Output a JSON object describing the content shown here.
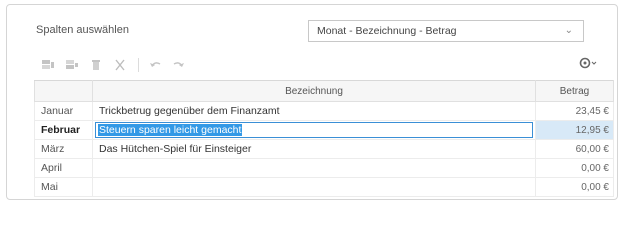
{
  "header": {
    "title": "Spalten auswählen",
    "column_select": {
      "value": "Monat - Bezeichnung - Betrag"
    }
  },
  "toolbar": {
    "icons": [
      "add-row-icon",
      "insert-row-icon",
      "delete-icon",
      "cut-icon",
      "undo-icon",
      "redo-icon",
      "settings-gear-icon"
    ]
  },
  "table": {
    "columns": [
      "",
      "Bezeichnung",
      "Betrag"
    ],
    "rows": [
      {
        "month": "Januar",
        "label": "Trickbetrug gegenüber dem Finanzamt",
        "amount": "23,45 €"
      },
      {
        "month": "Februar",
        "label": "Steuern sparen leicht gemacht",
        "amount": "12,95 €"
      },
      {
        "month": "März",
        "label": "Das Hütchen-Spiel für Einsteiger",
        "amount": "60,00 €"
      },
      {
        "month": "April",
        "label": "",
        "amount": "0,00 €"
      },
      {
        "month": "Mai",
        "label": "",
        "amount": "0,00 €"
      }
    ],
    "active_row": 1
  }
}
